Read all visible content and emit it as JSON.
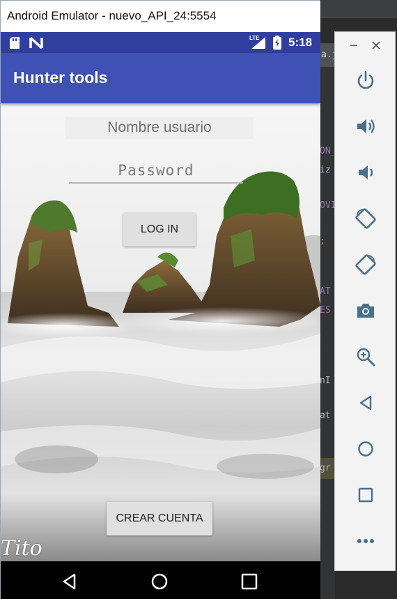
{
  "emulator": {
    "title": "Android Emulator - nuevo_API_24:5554"
  },
  "statusbar": {
    "time": "5:18",
    "network": "LTE"
  },
  "app": {
    "title": "Hunter tools"
  },
  "login_form": {
    "username_placeholder": "Nombre usuario",
    "password_placeholder": "Password",
    "login_label": "LOG IN",
    "create_account_label": "CREAR CUENTA"
  },
  "background": {
    "watermark": "Tito"
  },
  "ide": {
    "tab_text": "a.ja",
    "code_fragments": [
      {
        "text": "ON_",
        "color": "#9876aa"
      },
      {
        "text": "iz",
        "color": "#a9b7c6"
      },
      {
        "text": "OVI",
        "color": "#9876aa"
      },
      {
        "text": ";",
        "color": "#cc7832"
      },
      {
        "text": "AT",
        "color": "#9876aa"
      },
      {
        "text": "ES",
        "color": "#9876aa"
      },
      {
        "text": "nI",
        "color": "#a9b7c6"
      },
      {
        "text": "at",
        "color": "#a9b7c6"
      },
      {
        "text": "gr",
        "color": "#a9b7c6"
      }
    ]
  },
  "toolbar": {
    "items": [
      {
        "name": "minimize-icon"
      },
      {
        "name": "close-icon"
      },
      {
        "name": "power-icon"
      },
      {
        "name": "volume-up-icon"
      },
      {
        "name": "volume-down-icon"
      },
      {
        "name": "rotate-left-icon"
      },
      {
        "name": "rotate-right-icon"
      },
      {
        "name": "camera-icon"
      },
      {
        "name": "zoom-icon"
      },
      {
        "name": "back-icon"
      },
      {
        "name": "home-icon"
      },
      {
        "name": "overview-icon"
      },
      {
        "name": "more-icon"
      }
    ]
  },
  "colors": {
    "primary": "#3f51b5",
    "primary_dark": "#303f9f",
    "toolbar_icon": "#4a6f8a"
  }
}
